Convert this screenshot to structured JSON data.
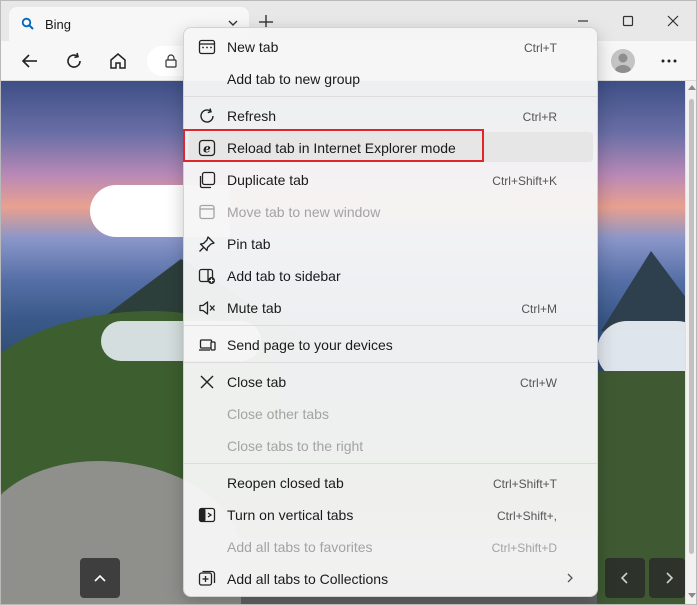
{
  "tab": {
    "title": "Bing",
    "favicon": "search-icon"
  },
  "menu": {
    "items": [
      {
        "label": "New tab",
        "shortcut": "Ctrl+T",
        "icon": "new-tab-icon",
        "disabled": false
      },
      {
        "label": "Add tab to new group",
        "shortcut": "",
        "icon": "",
        "disabled": false
      },
      {
        "label": "Refresh",
        "shortcut": "Ctrl+R",
        "icon": "refresh-icon",
        "disabled": false
      },
      {
        "label": "Reload tab in Internet Explorer mode",
        "shortcut": "",
        "icon": "ie-mode-icon",
        "disabled": false
      },
      {
        "label": "Duplicate tab",
        "shortcut": "Ctrl+Shift+K",
        "icon": "duplicate-icon",
        "disabled": false
      },
      {
        "label": "Move tab to new window",
        "shortcut": "",
        "icon": "move-window-icon",
        "disabled": true
      },
      {
        "label": "Pin tab",
        "shortcut": "",
        "icon": "pin-icon",
        "disabled": false
      },
      {
        "label": "Add tab to sidebar",
        "shortcut": "",
        "icon": "sidebar-icon",
        "disabled": false
      },
      {
        "label": "Mute tab",
        "shortcut": "Ctrl+M",
        "icon": "mute-icon",
        "disabled": false
      },
      {
        "label": "Send page to your devices",
        "shortcut": "",
        "icon": "devices-icon",
        "disabled": false
      },
      {
        "label": "Close tab",
        "shortcut": "Ctrl+W",
        "icon": "close-icon",
        "disabled": false
      },
      {
        "label": "Close other tabs",
        "shortcut": "",
        "icon": "",
        "disabled": true
      },
      {
        "label": "Close tabs to the right",
        "shortcut": "",
        "icon": "",
        "disabled": true
      },
      {
        "label": "Reopen closed tab",
        "shortcut": "Ctrl+Shift+T",
        "icon": "",
        "disabled": false
      },
      {
        "label": "Turn on vertical tabs",
        "shortcut": "Ctrl+Shift+,",
        "icon": "vertical-tabs-icon",
        "disabled": false
      },
      {
        "label": "Add all tabs to favorites",
        "shortcut": "Ctrl+Shift+D",
        "icon": "",
        "disabled": true
      },
      {
        "label": "Add all tabs to Collections",
        "shortcut": "",
        "icon": "collections-icon",
        "disabled": false
      }
    ]
  },
  "colors": {
    "highlight_box": "#e0252b",
    "accent": "#0067c0"
  }
}
